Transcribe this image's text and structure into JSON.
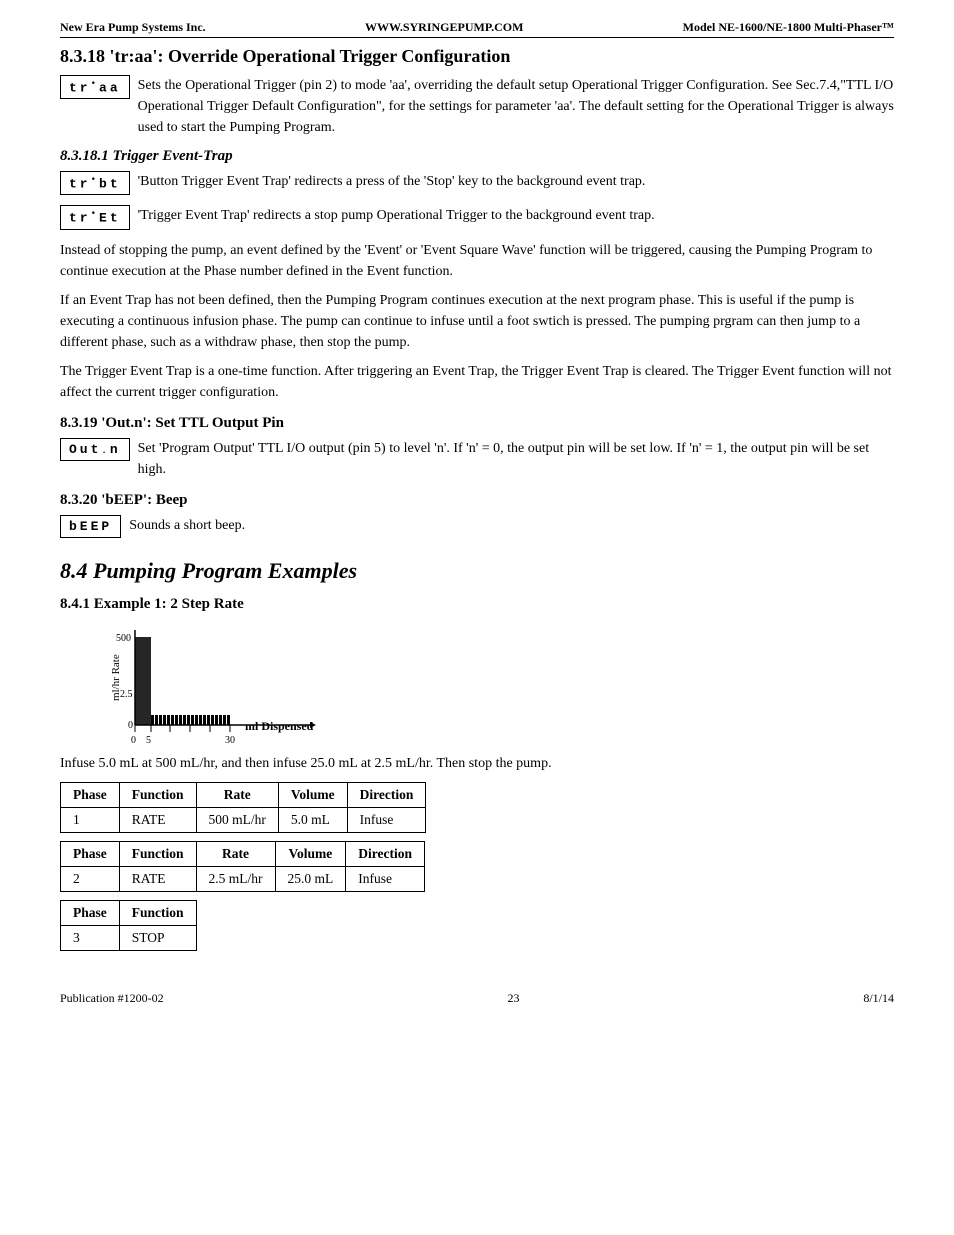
{
  "header": {
    "left": "New Era Pump Systems Inc.",
    "center": "WWW.SYRINGEPUMP.COM",
    "right": "Model NE-1600/NE-1800 Multi-Phaser™"
  },
  "sections": {
    "s8318": {
      "title": "8.3.18  'tr:aa': Override Operational Trigger Configuration",
      "lcd_traa": "tr•aa",
      "desc1": "Sets the Operational Trigger (pin 2) to mode 'aa', overriding the default setup Operational Trigger Configuration.  See Sec.7.4,\"TTL I/O Operational Trigger Default Configuration\", for the settings for parameter 'aa'.  The default setting for the Operational Trigger is always used to start the Pumping Program.",
      "sub1": {
        "title": "8.3.18.1  Trigger Event-Trap",
        "lcd1": "tr•bt",
        "desc1": "'Button Trigger Event Trap' redirects a press of the 'Stop' key to the background event trap.",
        "lcd2": "tr•Et",
        "desc2": "'Trigger Event Trap' redirects a stop pump Operational Trigger to the background event trap.",
        "para1": "Instead of stopping the pump, an event defined by the 'Event' or 'Event Square Wave' function will be triggered, causing the Pumping Program to continue execution at the Phase number defined in the Event function.",
        "para2": "If an Event Trap has not been defined, then the Pumping Program continues execution at the next program phase.  This is useful if the pump is executing a continuous infusion phase.  The pump can continue to infuse until a foot swtich is pressed.   The pumping prgram can then jump to a different phase, such as a withdraw phase, then stop the pump.",
        "para3": "The Trigger Event Trap is a one-time function.  After triggering an Event Trap, the Trigger Event Trap is cleared.  The Trigger Event function will not affect the current trigger configuration."
      }
    },
    "s8319": {
      "title": "8.3.19  'Out.n': Set TTL Output Pin",
      "lcd": "Out.n",
      "desc": "Set 'Program Output' TTL I/O output (pin 5) to level 'n'. If 'n' =  0, the output pin will be set low.  If 'n' = 1, the output pin will be set high."
    },
    "s8320": {
      "title": "8.3.20  'bEEP':  Beep",
      "lcd": "bEEP",
      "desc": "Sounds a short beep."
    },
    "s84": {
      "title": "8.4  Pumping Program Examples",
      "s841": {
        "title": "8.4.1  Example 1:  2 Step Rate",
        "chart": {
          "y_label": "ml/hr Rate",
          "y_values": [
            "500",
            "2.5",
            "0"
          ],
          "x_values": [
            "0",
            "5",
            "30"
          ],
          "x_label": "ml Dispensed",
          "bars": [
            {
              "x": 0,
              "width": 15,
              "height": 90
            },
            {
              "x": 15,
              "width": 100,
              "height": 10
            }
          ]
        },
        "para": "Infuse 5.0 mL at 500 mL/hr, and then infuse 25.0 mL at 2.5 mL/hr.  Then stop the pump.",
        "tables": [
          {
            "headers": [
              "Phase",
              "Function",
              "Rate",
              "Volume",
              "Direction"
            ],
            "rows": [
              [
                "1",
                "RATE",
                "500 mL/hr",
                "5.0 mL",
                "Infuse"
              ]
            ]
          },
          {
            "headers": [
              "Phase",
              "Function",
              "Rate",
              "Volume",
              "Direction"
            ],
            "rows": [
              [
                "2",
                "RATE",
                "2.5 mL/hr",
                "25.0 mL",
                "Infuse"
              ]
            ]
          },
          {
            "headers": [
              "Phase",
              "Function"
            ],
            "rows": [
              [
                "3",
                "STOP"
              ]
            ]
          }
        ]
      }
    }
  },
  "footer": {
    "left": "Publication  #1200-02",
    "center": "23",
    "right": "8/1/14"
  }
}
